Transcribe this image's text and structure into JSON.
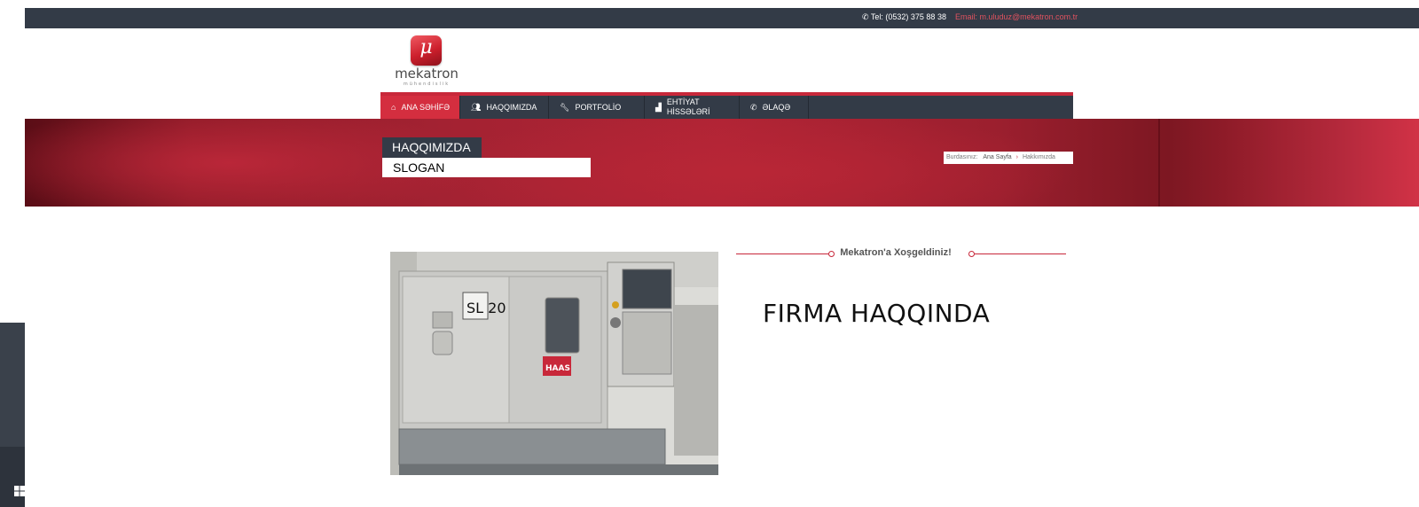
{
  "topbar": {
    "phone": "Tel: (0532) 375 88 38",
    "email": "Email: m.uluduz@mekatron.com.tr",
    "icons": {
      "phone": "phone-icon"
    }
  },
  "logo": {
    "mark": "μ",
    "name": "mekatron",
    "sub": "mühendislik"
  },
  "nav": {
    "items": [
      {
        "label": "ANA SƏHİFƏ",
        "icon": "home-icon",
        "active": true
      },
      {
        "label": "HAQQIMIZDA",
        "icon": "users-icon",
        "active": false
      },
      {
        "label": "PORTFOLİO",
        "icon": "wrench-icon",
        "active": false
      },
      {
        "label": "EHTİYAT HİSSƏLƏRİ",
        "icon": "puzzle-icon",
        "active": false
      },
      {
        "label": "ƏLAQƏ",
        "icon": "phone-icon",
        "active": false
      }
    ]
  },
  "banner": {
    "title": "HAQQIMIZDA",
    "slogan": "SLOGAN",
    "breadcrumb": {
      "prefix": "Burdasınız:",
      "home": "Ana Sayfa",
      "separator": "›",
      "current": "Hakkımızda"
    }
  },
  "content": {
    "welcome": "Mekatron'a Xoşgeldiniz!",
    "heading": "FIRMA HAQQINDA",
    "photo": {
      "model": "SL 20",
      "brand": "HAAS"
    }
  },
  "colors": {
    "dark": "#333b47",
    "accent": "#c8283a",
    "active_nav": "#d42e3f",
    "email": "#e0525f"
  }
}
